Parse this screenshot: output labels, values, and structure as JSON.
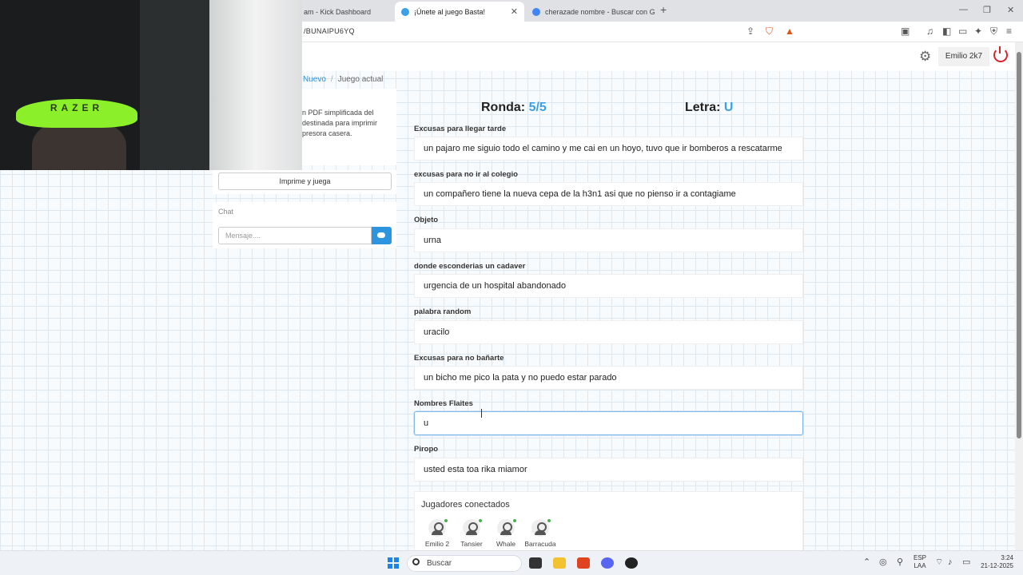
{
  "browser": {
    "tabs": [
      {
        "label": "am - Kick Dashboard",
        "favicon_color": "#53fc18"
      },
      {
        "label": "¡Únete al juego Basta!",
        "favicon_color": "#3aa0e8"
      },
      {
        "label": "cherazade nombre - Buscar con Goo",
        "favicon_color": "#4285f4"
      }
    ],
    "new_tab_glyph": "+",
    "url": "/BUNAIPU6YQ"
  },
  "header": {
    "username": "Emilio 2k7"
  },
  "breadcrumb": {
    "link": "Nuevo",
    "current": "Juego actual"
  },
  "sidebar": {
    "info_text": "n PDF simplificada del destinada para imprimir presora casera.",
    "print_button": "Imprime y juega",
    "chat_title": "Chat",
    "chat_placeholder": "Mensaje...."
  },
  "game": {
    "round_label": "Ronda:",
    "round_value": "5/5",
    "letter_label": "Letra:",
    "letter_value": "U",
    "fields": [
      {
        "label": "Excusas para llegar tarde",
        "value": "un pajaro me siguio todo el camino y me cai en un hoyo, tuvo que ir bomberos a rescatarme"
      },
      {
        "label": "excusas para no ir al colegio",
        "value": "un compañero tiene la nueva cepa de la h3n1 asi que no pienso ir a contagiame"
      },
      {
        "label": "Objeto",
        "value": "urna"
      },
      {
        "label": "donde esconderias un cadaver",
        "value": "urgencia de un hospital abandonado"
      },
      {
        "label": "palabra random",
        "value": "uracilo"
      },
      {
        "label": "Excusas para no bañarte",
        "value": "un bicho me pico la pata y no puedo estar parado"
      },
      {
        "label": "Nombres Flaites",
        "value": "u"
      },
      {
        "label": "Piropo",
        "value": "usted esta toa rika miamor"
      }
    ],
    "players_title": "Jugadores conectados",
    "players": [
      "Emilio 2",
      "Tansier",
      "Whale",
      "Barracuda"
    ]
  },
  "webcam": {
    "headband_text": "RAZER"
  },
  "taskbar": {
    "search_label": "Buscar",
    "lang": [
      "ESP",
      "LAA"
    ],
    "time": "3:24",
    "date": "21-12-2025"
  },
  "colors": {
    "accent": "#3aa0e8",
    "power": "#d9232d",
    "online": "#4caf50"
  }
}
